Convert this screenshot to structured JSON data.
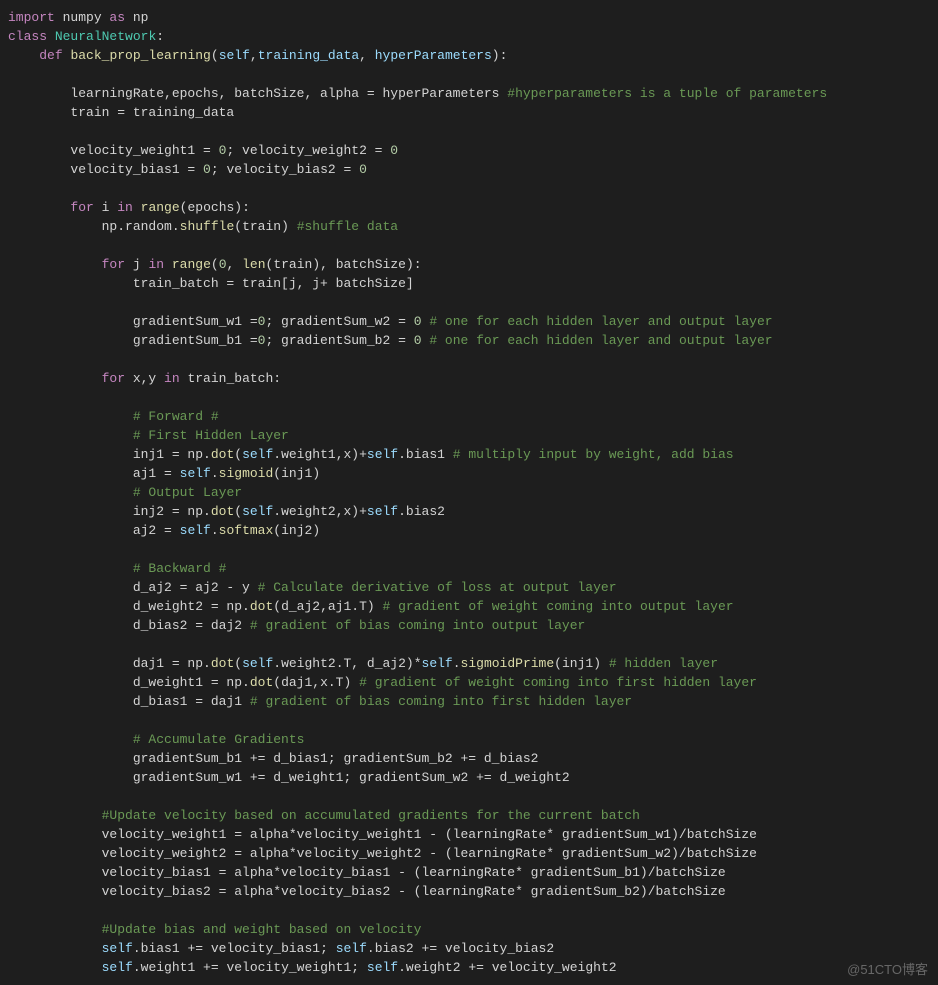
{
  "watermark": "@51CTO博客",
  "code": {
    "lines": [
      [
        {
          "c": "kw",
          "t": "import"
        },
        {
          "c": "op",
          "t": " numpy "
        },
        {
          "c": "kw",
          "t": "as"
        },
        {
          "c": "op",
          "t": " np"
        }
      ],
      [
        {
          "c": "kw",
          "t": "class"
        },
        {
          "c": "op",
          "t": " "
        },
        {
          "c": "mod",
          "t": "NeuralNetwork"
        },
        {
          "c": "pun",
          "t": ":"
        }
      ],
      [
        {
          "c": "op",
          "t": "    "
        },
        {
          "c": "kw",
          "t": "def"
        },
        {
          "c": "op",
          "t": " "
        },
        {
          "c": "fn",
          "t": "back_prop_learning"
        },
        {
          "c": "pun",
          "t": "("
        },
        {
          "c": "var",
          "t": "self"
        },
        {
          "c": "pun",
          "t": ","
        },
        {
          "c": "var",
          "t": "training_data"
        },
        {
          "c": "pun",
          "t": ", "
        },
        {
          "c": "var",
          "t": "hyperParameters"
        },
        {
          "c": "pun",
          "t": "):"
        }
      ],
      [
        {
          "c": "op",
          "t": ""
        }
      ],
      [
        {
          "c": "op",
          "t": "        learningRate,epochs, batchSize, alpha = hyperParameters "
        },
        {
          "c": "cmt",
          "t": "#hyperparameters is a tuple of parameters"
        }
      ],
      [
        {
          "c": "op",
          "t": "        train = training_data"
        }
      ],
      [
        {
          "c": "op",
          "t": ""
        }
      ],
      [
        {
          "c": "op",
          "t": "        velocity_weight1 = "
        },
        {
          "c": "num",
          "t": "0"
        },
        {
          "c": "op",
          "t": "; velocity_weight2 = "
        },
        {
          "c": "num",
          "t": "0"
        }
      ],
      [
        {
          "c": "op",
          "t": "        velocity_bias1 = "
        },
        {
          "c": "num",
          "t": "0"
        },
        {
          "c": "op",
          "t": "; velocity_bias2 = "
        },
        {
          "c": "num",
          "t": "0"
        }
      ],
      [
        {
          "c": "op",
          "t": ""
        }
      ],
      [
        {
          "c": "op",
          "t": "        "
        },
        {
          "c": "kw",
          "t": "for"
        },
        {
          "c": "op",
          "t": " i "
        },
        {
          "c": "kw",
          "t": "in"
        },
        {
          "c": "op",
          "t": " "
        },
        {
          "c": "fn",
          "t": "range"
        },
        {
          "c": "pun",
          "t": "("
        },
        {
          "c": "op",
          "t": "epochs"
        },
        {
          "c": "pun",
          "t": "):"
        }
      ],
      [
        {
          "c": "op",
          "t": "            np.random."
        },
        {
          "c": "fn",
          "t": "shuffle"
        },
        {
          "c": "pun",
          "t": "("
        },
        {
          "c": "op",
          "t": "train"
        },
        {
          "c": "pun",
          "t": ") "
        },
        {
          "c": "cmt",
          "t": "#shuffle data"
        }
      ],
      [
        {
          "c": "op",
          "t": ""
        }
      ],
      [
        {
          "c": "op",
          "t": "            "
        },
        {
          "c": "kw",
          "t": "for"
        },
        {
          "c": "op",
          "t": " j "
        },
        {
          "c": "kw",
          "t": "in"
        },
        {
          "c": "op",
          "t": " "
        },
        {
          "c": "fn",
          "t": "range"
        },
        {
          "c": "pun",
          "t": "("
        },
        {
          "c": "num",
          "t": "0"
        },
        {
          "c": "pun",
          "t": ", "
        },
        {
          "c": "fn",
          "t": "len"
        },
        {
          "c": "pun",
          "t": "("
        },
        {
          "c": "op",
          "t": "train"
        },
        {
          "c": "pun",
          "t": "), "
        },
        {
          "c": "op",
          "t": "batchSize"
        },
        {
          "c": "pun",
          "t": "):"
        }
      ],
      [
        {
          "c": "op",
          "t": "                train_batch = train[j, j+ batchSize]"
        }
      ],
      [
        {
          "c": "op",
          "t": ""
        }
      ],
      [
        {
          "c": "op",
          "t": "                gradientSum_w1 ="
        },
        {
          "c": "num",
          "t": "0"
        },
        {
          "c": "op",
          "t": "; gradientSum_w2 = "
        },
        {
          "c": "num",
          "t": "0"
        },
        {
          "c": "op",
          "t": " "
        },
        {
          "c": "cmt",
          "t": "# one for each hidden layer and output layer"
        }
      ],
      [
        {
          "c": "op",
          "t": "                gradientSum_b1 ="
        },
        {
          "c": "num",
          "t": "0"
        },
        {
          "c": "op",
          "t": "; gradientSum_b2 = "
        },
        {
          "c": "num",
          "t": "0"
        },
        {
          "c": "op",
          "t": " "
        },
        {
          "c": "cmt",
          "t": "# one for each hidden layer and output layer"
        }
      ],
      [
        {
          "c": "op",
          "t": ""
        }
      ],
      [
        {
          "c": "op",
          "t": "            "
        },
        {
          "c": "kw",
          "t": "for"
        },
        {
          "c": "op",
          "t": " x,y "
        },
        {
          "c": "kw",
          "t": "in"
        },
        {
          "c": "op",
          "t": " train_batch:"
        }
      ],
      [
        {
          "c": "op",
          "t": ""
        }
      ],
      [
        {
          "c": "op",
          "t": "                "
        },
        {
          "c": "cmt",
          "t": "# Forward #"
        }
      ],
      [
        {
          "c": "op",
          "t": "                "
        },
        {
          "c": "cmt",
          "t": "# First Hidden Layer"
        }
      ],
      [
        {
          "c": "op",
          "t": "                inj1 = np."
        },
        {
          "c": "fn",
          "t": "dot"
        },
        {
          "c": "pun",
          "t": "("
        },
        {
          "c": "slf",
          "t": "self"
        },
        {
          "c": "op",
          "t": ".weight1,x)+"
        },
        {
          "c": "slf",
          "t": "self"
        },
        {
          "c": "op",
          "t": ".bias1 "
        },
        {
          "c": "cmt",
          "t": "# multiply input by weight, add bias"
        }
      ],
      [
        {
          "c": "op",
          "t": "                aj1 = "
        },
        {
          "c": "slf",
          "t": "self"
        },
        {
          "c": "op",
          "t": "."
        },
        {
          "c": "fn",
          "t": "sigmoid"
        },
        {
          "c": "pun",
          "t": "("
        },
        {
          "c": "op",
          "t": "inj1"
        },
        {
          "c": "pun",
          "t": ")"
        }
      ],
      [
        {
          "c": "op",
          "t": "                "
        },
        {
          "c": "cmt",
          "t": "# Output Layer"
        }
      ],
      [
        {
          "c": "op",
          "t": "                inj2 = np."
        },
        {
          "c": "fn",
          "t": "dot"
        },
        {
          "c": "pun",
          "t": "("
        },
        {
          "c": "slf",
          "t": "self"
        },
        {
          "c": "op",
          "t": ".weight2,x)+"
        },
        {
          "c": "slf",
          "t": "self"
        },
        {
          "c": "op",
          "t": ".bias2"
        }
      ],
      [
        {
          "c": "op",
          "t": "                aj2 = "
        },
        {
          "c": "slf",
          "t": "self"
        },
        {
          "c": "op",
          "t": "."
        },
        {
          "c": "fn",
          "t": "softmax"
        },
        {
          "c": "pun",
          "t": "("
        },
        {
          "c": "op",
          "t": "inj2"
        },
        {
          "c": "pun",
          "t": ")"
        }
      ],
      [
        {
          "c": "op",
          "t": ""
        }
      ],
      [
        {
          "c": "op",
          "t": "                "
        },
        {
          "c": "cmt",
          "t": "# Backward #"
        }
      ],
      [
        {
          "c": "op",
          "t": "                d_aj2 = aj2 - y "
        },
        {
          "c": "cmt",
          "t": "# Calculate derivative of loss at output layer"
        }
      ],
      [
        {
          "c": "op",
          "t": "                d_weight2 = np."
        },
        {
          "c": "fn",
          "t": "dot"
        },
        {
          "c": "pun",
          "t": "("
        },
        {
          "c": "op",
          "t": "d_aj2,aj1.T"
        },
        {
          "c": "pun",
          "t": ") "
        },
        {
          "c": "cmt",
          "t": "# gradient of weight coming into output layer"
        }
      ],
      [
        {
          "c": "op",
          "t": "                d_bias2 = daj2 "
        },
        {
          "c": "cmt",
          "t": "# gradient of bias coming into output layer"
        }
      ],
      [
        {
          "c": "op",
          "t": ""
        }
      ],
      [
        {
          "c": "op",
          "t": "                daj1 = np."
        },
        {
          "c": "fn",
          "t": "dot"
        },
        {
          "c": "pun",
          "t": "("
        },
        {
          "c": "slf",
          "t": "self"
        },
        {
          "c": "op",
          "t": ".weight2.T, d_aj2)*"
        },
        {
          "c": "slf",
          "t": "self"
        },
        {
          "c": "op",
          "t": "."
        },
        {
          "c": "fn",
          "t": "sigmoidPrime"
        },
        {
          "c": "pun",
          "t": "("
        },
        {
          "c": "op",
          "t": "inj1"
        },
        {
          "c": "pun",
          "t": ") "
        },
        {
          "c": "cmt",
          "t": "# hidden layer"
        }
      ],
      [
        {
          "c": "op",
          "t": "                d_weight1 = np."
        },
        {
          "c": "fn",
          "t": "dot"
        },
        {
          "c": "pun",
          "t": "("
        },
        {
          "c": "op",
          "t": "daj1,x.T"
        },
        {
          "c": "pun",
          "t": ") "
        },
        {
          "c": "cmt",
          "t": "# gradient of weight coming into first hidden layer"
        }
      ],
      [
        {
          "c": "op",
          "t": "                d_bias1 = daj1 "
        },
        {
          "c": "cmt",
          "t": "# gradient of bias coming into first hidden layer"
        }
      ],
      [
        {
          "c": "op",
          "t": ""
        }
      ],
      [
        {
          "c": "op",
          "t": "                "
        },
        {
          "c": "cmt",
          "t": "# Accumulate Gradients"
        }
      ],
      [
        {
          "c": "op",
          "t": "                gradientSum_b1 += d_bias1; gradientSum_b2 += d_bias2"
        }
      ],
      [
        {
          "c": "op",
          "t": "                gradientSum_w1 += d_weight1; gradientSum_w2 += d_weight2"
        }
      ],
      [
        {
          "c": "op",
          "t": ""
        }
      ],
      [
        {
          "c": "op",
          "t": "            "
        },
        {
          "c": "cmt",
          "t": "#Update velocity based on accumulated gradients for the current batch"
        }
      ],
      [
        {
          "c": "op",
          "t": "            velocity_weight1 = alpha*velocity_weight1 - (learningRate* gradientSum_w1)/batchSize"
        }
      ],
      [
        {
          "c": "op",
          "t": "            velocity_weight2 = alpha*velocity_weight2 - (learningRate* gradientSum_w2)/batchSize"
        }
      ],
      [
        {
          "c": "op",
          "t": "            velocity_bias1 = alpha*velocity_bias1 - (learningRate* gradientSum_b1)/batchSize"
        }
      ],
      [
        {
          "c": "op",
          "t": "            velocity_bias2 = alpha*velocity_bias2 - (learningRate* gradientSum_b2)/batchSize"
        }
      ],
      [
        {
          "c": "op",
          "t": ""
        }
      ],
      [
        {
          "c": "op",
          "t": "            "
        },
        {
          "c": "cmt",
          "t": "#Update bias and weight based on velocity"
        }
      ],
      [
        {
          "c": "op",
          "t": "            "
        },
        {
          "c": "slf",
          "t": "self"
        },
        {
          "c": "op",
          "t": ".bias1 += velocity_bias1; "
        },
        {
          "c": "slf",
          "t": "self"
        },
        {
          "c": "op",
          "t": ".bias2 += velocity_bias2"
        }
      ],
      [
        {
          "c": "op",
          "t": "            "
        },
        {
          "c": "slf",
          "t": "self"
        },
        {
          "c": "op",
          "t": ".weight1 += velocity_weight1; "
        },
        {
          "c": "slf",
          "t": "self"
        },
        {
          "c": "op",
          "t": ".weight2 += velocity_weight2"
        }
      ]
    ]
  }
}
